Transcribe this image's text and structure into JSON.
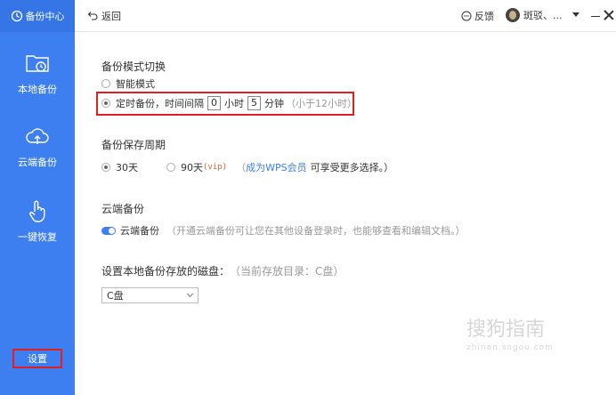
{
  "sidebar": {
    "title": "备份中心",
    "items": [
      {
        "label": "本地备份",
        "icon": "folder-clock-icon"
      },
      {
        "label": "云端备份",
        "icon": "cloud-upload-icon"
      },
      {
        "label": "一键恢复",
        "icon": "hand-pointer-icon"
      }
    ],
    "settings_label": "设置"
  },
  "topbar": {
    "back_label": "返回",
    "feedback_label": "反馈",
    "user_name": "斑驳、..."
  },
  "mode": {
    "title": "备份模式切换",
    "smart_label": "智能模式",
    "timed_label": "定时备份，时间间隔",
    "hours_value": "0",
    "hours_unit": "小时",
    "minutes_value": "5",
    "minutes_unit": "分钟",
    "hint": "（小于12小时）"
  },
  "retention": {
    "title": "备份保存周期",
    "opt30": "30天",
    "opt90": "90天",
    "vip_tag": "(vip)",
    "link_prefix": "（",
    "link_text": "成为WPS会员",
    "link_suffix": "可享受更多选择。）"
  },
  "cloud": {
    "title": "云端备份",
    "toggle_label": "云端备份",
    "hint": "（开通云端备份可让您在其他设备登录时，也能够查看和编辑文档。）"
  },
  "disk": {
    "title": "设置本地备份存放的磁盘：",
    "current_hint": "（当前存放目录：C盘）",
    "selected": "C盘"
  },
  "watermark": {
    "text": "搜狗指南",
    "sub": "zhinan.sogou.com"
  },
  "colors": {
    "accent": "#3d7ff0",
    "highlight_red": "#e02020"
  }
}
